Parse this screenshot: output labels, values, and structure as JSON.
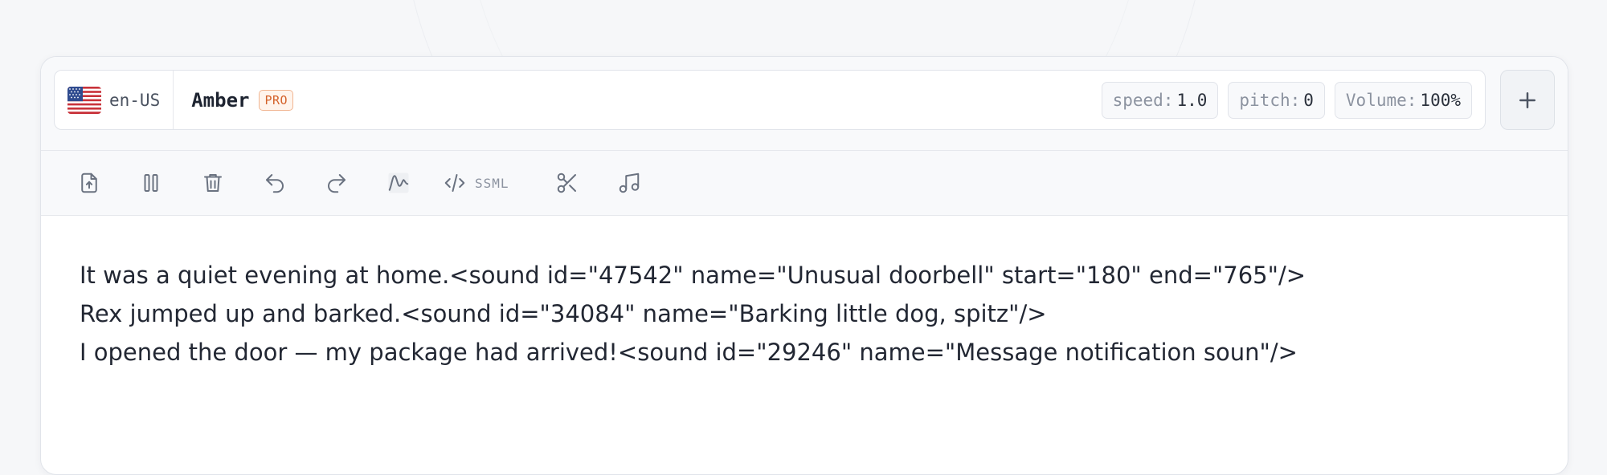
{
  "voice_bar": {
    "language_code": "en-US",
    "flag_icon": "us-flag-icon",
    "voice_name": "Amber",
    "badge": "PRO",
    "params": [
      {
        "key": "speed:",
        "value": "1.0"
      },
      {
        "key": "pitch:",
        "value": "0"
      },
      {
        "key": "Volume:",
        "value": "100%"
      }
    ],
    "add_icon": "plus-icon"
  },
  "toolbar": {
    "tools": [
      "upload-file-icon",
      "pause-icon",
      "trash-icon",
      "undo-icon",
      "redo-icon",
      "waveform-icon",
      "ssml-code-icon",
      "scissors-icon",
      "music-note-icon"
    ],
    "ssml_label": "SSML"
  },
  "editor": {
    "lines": [
      "It was a quiet evening at home.<sound id=\"47542\" name=\"Unusual doorbell\" start=\"180\" end=\"765\"/>",
      "Rex jumped up and barked.<sound id=\"34084\" name=\"Barking little dog, spitz\"/>",
      "I opened the door — my package had arrived!<sound id=\"29246\" name=\"Message notification soun\"/>"
    ]
  },
  "colors": {
    "accent_badge": "#d4622b",
    "text": "#222733",
    "muted": "#8c93a0"
  }
}
